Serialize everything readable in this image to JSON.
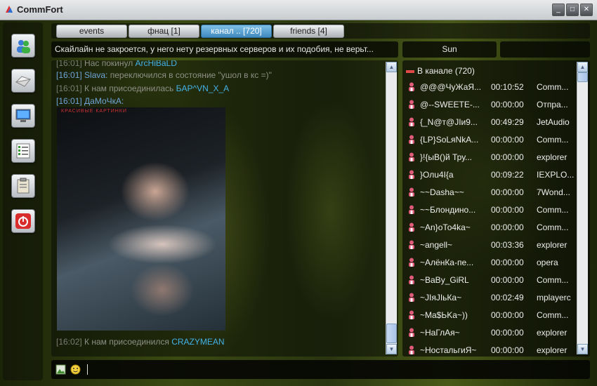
{
  "window": {
    "title": "CommFort",
    "btn_minimize": "_",
    "btn_maximize": "□",
    "btn_close": "✕"
  },
  "tabs": [
    {
      "label": "events"
    },
    {
      "label": "фнац [1]"
    },
    {
      "label": "канал .. [720]"
    },
    {
      "label": "friends [4]"
    }
  ],
  "topic": "Скайлайн не закроется, у него нету резервных серверов и их подобия, не верьт...",
  "current_nick": "Sun",
  "chat": {
    "messages": [
      {
        "time": "[16:01]",
        "text": " Нас покинул ",
        "who": "ArcHiBaLD"
      },
      {
        "time": "[16:01]",
        "nick": " Slava:",
        "text": " переключился в состояние \"ушол в кс =)\""
      },
      {
        "time": "[16:01]",
        "text": " К нам присоединилась ",
        "who": "БAP^VN_X_A"
      },
      {
        "time": "[16:01]",
        "nick": " ДаМоЧкА:"
      },
      {
        "time": "[16:02]",
        "text": " К нам присоединился ",
        "who": "CRAZYMEAN"
      }
    ],
    "image_caption": "КРАСИВЫЕ КАРТИНКИ"
  },
  "users": {
    "header": "В канале (720)",
    "rows": [
      {
        "name": "@@@ЧуЖаЯ...",
        "time": "00:10:52",
        "client": "Comm..."
      },
      {
        "name": "@--SWEETE-...",
        "time": "00:00:00",
        "client": "Отпра..."
      },
      {
        "name": "{_N@т@JIи9...",
        "time": "00:49:29",
        "client": "JetAudio"
      },
      {
        "name": "{LP}SoLяNkA...",
        "time": "00:00:00",
        "client": "Comm..."
      },
      {
        "name": "}!{ыВ()й Тру...",
        "time": "00:00:00",
        "client": "explorer"
      },
      {
        "name": "}Олu4I{a",
        "time": "00:09:22",
        "client": "IEXPLO..."
      },
      {
        "name": "~~Dasha~~",
        "time": "00:00:00",
        "client": "7Wond..."
      },
      {
        "name": "~~Блондино...",
        "time": "00:00:00",
        "client": "Comm..."
      },
      {
        "name": "~An}оТо4ka~",
        "time": "00:00:00",
        "client": "Comm..."
      },
      {
        "name": "~angell~",
        "time": "00:03:36",
        "client": "explorer"
      },
      {
        "name": "~АлёнКа-пе...",
        "time": "00:00:00",
        "client": "opera"
      },
      {
        "name": "~BaBy_GiRL",
        "time": "00:00:00",
        "client": "Comm..."
      },
      {
        "name": "~JIяJIьКа~",
        "time": "00:02:49",
        "client": "mplayerc"
      },
      {
        "name": "~Ma$ЬKa~))",
        "time": "00:00:00",
        "client": "Comm..."
      },
      {
        "name": "~НаГлАя~",
        "time": "00:00:00",
        "client": "explorer"
      },
      {
        "name": "~НостальгиЯ~",
        "time": "00:00:00",
        "client": "explorer"
      }
    ]
  },
  "colors": {
    "accent": "#3f89bf",
    "link": "#43b2e8",
    "nick": "#6fa4d8",
    "user_icon": "#e05a7a"
  }
}
